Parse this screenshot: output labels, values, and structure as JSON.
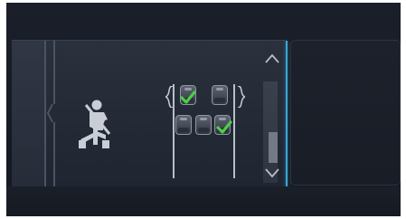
{
  "display": {
    "left_panel": {
      "icons": {
        "seatbelt": "seatbelt-warning-icon",
        "scroll_up": "chevron-up-icon",
        "scroll_down": "chevron-down-icon"
      },
      "seat_status": {
        "rows": [
          {
            "name": "front",
            "seats": [
              {
                "position": "front-left",
                "buckled": true
              },
              {
                "position": "front-right",
                "buckled": false
              }
            ]
          },
          {
            "name": "rear",
            "seats": [
              {
                "position": "rear-left",
                "buckled": false
              },
              {
                "position": "rear-center",
                "buckled": false
              },
              {
                "position": "rear-right",
                "buckled": true
              }
            ]
          }
        ]
      },
      "scroll": {
        "position_fraction": 0.55
      },
      "colors": {
        "accent": "#37a7d8",
        "check": "#4ccf45",
        "icon": "#c9ced6"
      }
    },
    "right_panel": {}
  }
}
